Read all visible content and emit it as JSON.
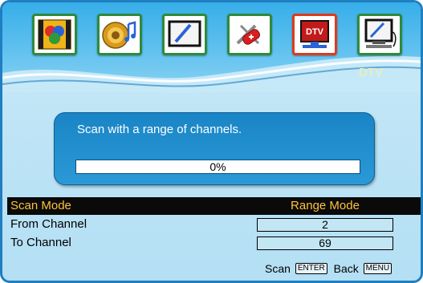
{
  "colors": {
    "frame_border": "#1f7fc0",
    "top_bar": "#37aee9",
    "panel": "#1a85c6",
    "highlight_row": "#0a0a0a",
    "highlight_text": "#ffc23a",
    "active_tab_border": "#e0391a",
    "tab_border": "#2e8b3b"
  },
  "tabs": [
    {
      "icon": "picture-icon",
      "active": false
    },
    {
      "icon": "sound-icon",
      "active": false
    },
    {
      "icon": "screen-icon",
      "active": false
    },
    {
      "icon": "tools-icon",
      "active": false
    },
    {
      "icon": "dtv-icon",
      "active": true,
      "icon_text": "DTV"
    },
    {
      "icon": "pc-monitor-icon",
      "active": false
    }
  ],
  "section_label": "DTV",
  "scan_panel": {
    "message": "Scan with a range of channels.",
    "progress_text": "0%",
    "progress_fraction": 0.0
  },
  "settings": [
    {
      "label": "Scan Mode",
      "value": "Range Mode",
      "selected": true
    },
    {
      "label": "From Channel",
      "value": "2",
      "selected": false
    },
    {
      "label": "To Channel",
      "value": "69",
      "selected": false
    }
  ],
  "footer": {
    "scan_label": "Scan",
    "scan_key": "ENTER",
    "back_label": "Back",
    "back_key": "MENU"
  }
}
